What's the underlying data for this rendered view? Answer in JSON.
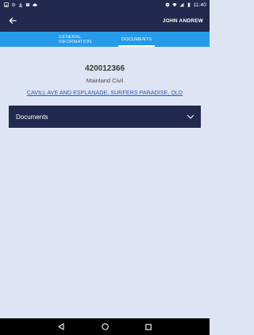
{
  "status_bar": {
    "time": "11:40",
    "left_icons": [
      "gallery-icon",
      "settings-icon",
      "download-icon",
      "storage-icon",
      "cloud-icon"
    ],
    "right_icons": [
      "dnd-icon",
      "wifi-icon",
      "signal-icon",
      "battery-icon"
    ]
  },
  "app_bar": {
    "user_name": "JOHN ANDREW",
    "back_icon": "arrow-left-icon"
  },
  "tabs": [
    {
      "label": "GENERAL INFORMATION",
      "active": false
    },
    {
      "label": "DOCUMENTS",
      "active": true
    }
  ],
  "job": {
    "number": "420012366",
    "type": "Mainland Civil",
    "address": "CAVILL AVE AND ESPLANADE, SURFERS PARADISE, QLD"
  },
  "documents_panel": {
    "label": "Documents",
    "icon": "chevron-down-icon"
  },
  "nav_bar": {
    "icons": [
      "back-triangle-icon",
      "home-circle-icon",
      "recents-square-icon"
    ]
  },
  "colors": {
    "app_bar": "#22294f",
    "tab_bar": "#279bea",
    "background": "#dfe4f5",
    "link": "#1f5fc0"
  }
}
